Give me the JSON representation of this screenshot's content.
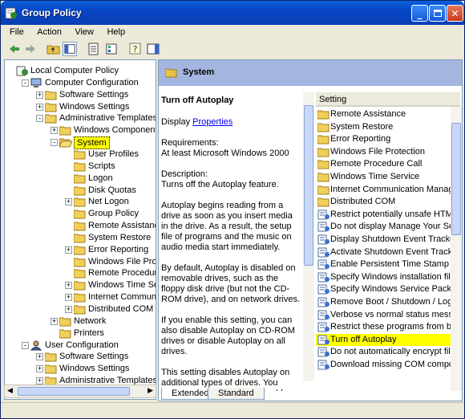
{
  "window": {
    "title": "Group Policy",
    "accent": "#0a46c4",
    "buttons": [
      "minimize",
      "maximize",
      "close"
    ]
  },
  "menu": [
    "File",
    "Action",
    "View",
    "Help"
  ],
  "toolbar": [
    "back-icon",
    "forward-icon",
    "up-folder-icon",
    "show-hide-tree-icon",
    "properties-icon",
    "export-list-icon",
    "help-icon",
    "show-hide-action-pane-icon"
  ],
  "tree": {
    "root": "Local Computer Policy",
    "items": [
      {
        "label": "Local Computer Policy",
        "level": 0,
        "icon": "computer-policy-icon"
      },
      {
        "label": "Computer Configuration",
        "level": 1,
        "icon": "computer-icon",
        "exp": "-"
      },
      {
        "label": "Software Settings",
        "level": 2,
        "icon": "folder-icon",
        "exp": "+"
      },
      {
        "label": "Windows Settings",
        "level": 2,
        "icon": "folder-icon",
        "exp": "+"
      },
      {
        "label": "Administrative Templates",
        "level": 2,
        "icon": "folder-icon",
        "exp": "-"
      },
      {
        "label": "Windows Components",
        "level": 3,
        "icon": "folder-icon",
        "exp": "+"
      },
      {
        "label": "System",
        "level": 3,
        "icon": "folder-open-icon",
        "exp": "-",
        "selected": true
      },
      {
        "label": "User Profiles",
        "level": 4,
        "icon": "folder-icon"
      },
      {
        "label": "Scripts",
        "level": 4,
        "icon": "folder-icon"
      },
      {
        "label": "Logon",
        "level": 4,
        "icon": "folder-icon"
      },
      {
        "label": "Disk Quotas",
        "level": 4,
        "icon": "folder-icon"
      },
      {
        "label": "Net Logon",
        "level": 4,
        "icon": "folder-icon",
        "exp": "+"
      },
      {
        "label": "Group Policy",
        "level": 4,
        "icon": "folder-icon"
      },
      {
        "label": "Remote Assistance",
        "level": 4,
        "icon": "folder-icon"
      },
      {
        "label": "System Restore",
        "level": 4,
        "icon": "folder-icon"
      },
      {
        "label": "Error Reporting",
        "level": 4,
        "icon": "folder-icon",
        "exp": "+"
      },
      {
        "label": "Windows File Protect",
        "level": 4,
        "icon": "folder-icon"
      },
      {
        "label": "Remote Procedure C",
        "level": 4,
        "icon": "folder-icon"
      },
      {
        "label": "Windows Time Servic",
        "level": 4,
        "icon": "folder-icon",
        "exp": "+"
      },
      {
        "label": "Internet Communica",
        "level": 4,
        "icon": "folder-icon",
        "exp": "+"
      },
      {
        "label": "Distributed COM",
        "level": 4,
        "icon": "folder-icon",
        "exp": "+"
      },
      {
        "label": "Network",
        "level": 3,
        "icon": "folder-icon",
        "exp": "+"
      },
      {
        "label": "Printers",
        "level": 3,
        "icon": "folder-icon"
      },
      {
        "label": "User Configuration",
        "level": 1,
        "icon": "user-icon",
        "exp": "-"
      },
      {
        "label": "Software Settings",
        "level": 2,
        "icon": "folder-icon",
        "exp": "+"
      },
      {
        "label": "Windows Settings",
        "level": 2,
        "icon": "folder-icon",
        "exp": "+"
      },
      {
        "label": "Administrative Templates",
        "level": 2,
        "icon": "folder-icon",
        "exp": "+"
      }
    ]
  },
  "detail": {
    "header": "System",
    "title": "Turn off Autoplay",
    "display_prefix": "Display",
    "properties_link": "Properties",
    "requirements_label": "Requirements:",
    "requirements_value": "At least Microsoft Windows 2000",
    "description_label": "Description:",
    "description_value": "Turns off the Autoplay feature.",
    "paragraphs": [
      "Autoplay begins reading from a drive as soon as you insert media in the drive. As a result, the setup file of programs and the music on audio media start immediately.",
      "By default, Autoplay is disabled on removable drives, such as the floppy disk drive (but not the CD-ROM drive), and on network drives.",
      "If you enable this setting, you can also disable Autoplay on CD-ROM drives or disable Autoplay on all drives.",
      "This setting disables Autoplay on additional types of drives. You cannot use this setting to enable Autoplay on drives on which it is disabled by"
    ]
  },
  "list": {
    "column": "Setting",
    "items": [
      {
        "label": "Remote Assistance",
        "icon": "folder-icon"
      },
      {
        "label": "System Restore",
        "icon": "folder-icon"
      },
      {
        "label": "Error Reporting",
        "icon": "folder-icon"
      },
      {
        "label": "Windows File Protection",
        "icon": "folder-icon"
      },
      {
        "label": "Remote Procedure Call",
        "icon": "folder-icon"
      },
      {
        "label": "Windows Time Service",
        "icon": "folder-icon"
      },
      {
        "label": "Internet Communication Manager",
        "icon": "folder-icon"
      },
      {
        "label": "Distributed COM",
        "icon": "folder-icon"
      },
      {
        "label": "Restrict potentially unsafe HTML H",
        "icon": "policy-setting-icon"
      },
      {
        "label": "Do not display Manage Your Server",
        "icon": "policy-setting-icon"
      },
      {
        "label": "Display Shutdown Event Tracker",
        "icon": "policy-setting-icon"
      },
      {
        "label": "Activate Shutdown Event Tracker",
        "icon": "policy-setting-icon"
      },
      {
        "label": "Enable Persistent Time Stamp",
        "icon": "policy-setting-icon"
      },
      {
        "label": "Specify Windows installation file lo",
        "icon": "policy-setting-icon"
      },
      {
        "label": "Specify Windows Service Pack inst",
        "icon": "policy-setting-icon"
      },
      {
        "label": "Remove Boot / Shutdown / Logon",
        "icon": "policy-setting-icon"
      },
      {
        "label": "Verbose vs normal status messag",
        "icon": "policy-setting-icon"
      },
      {
        "label": "Restrict these programs from bei",
        "icon": "policy-setting-icon"
      },
      {
        "label": "Turn off Autoplay",
        "icon": "policy-setting-icon",
        "selected": true
      },
      {
        "label": "Do not automatically encrypt files",
        "icon": "policy-setting-icon"
      },
      {
        "label": "Download missing COM componer",
        "icon": "policy-setting-icon"
      }
    ]
  },
  "tabs": [
    "Extended",
    "Standard"
  ],
  "highlight": "#ffff00"
}
